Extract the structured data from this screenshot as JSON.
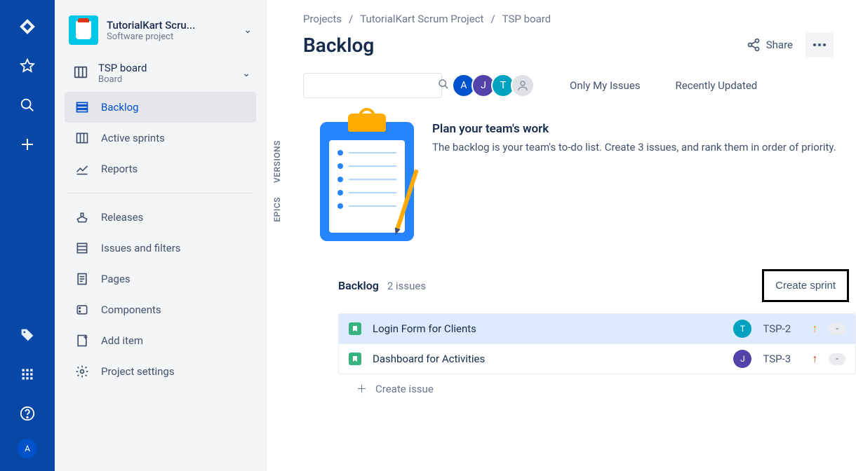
{
  "rail": {
    "user_initial": "A"
  },
  "sidebar": {
    "project": {
      "name": "TutorialKart Scru...",
      "subtitle": "Software project"
    },
    "board": {
      "name": "TSP board",
      "subtitle": "Board"
    },
    "nav": {
      "backlog": "Backlog",
      "active_sprints": "Active sprints",
      "reports": "Reports",
      "releases": "Releases",
      "issues_filters": "Issues and filters",
      "pages": "Pages",
      "components": "Components",
      "add_item": "Add item",
      "project_settings": "Project settings"
    }
  },
  "breadcrumb": {
    "projects": "Projects",
    "project": "TutorialKart Scrum Project",
    "board": "TSP board",
    "sep": "/"
  },
  "header": {
    "title": "Backlog",
    "share": "Share"
  },
  "toolbar": {
    "avatars": {
      "a": "A",
      "j": "J",
      "t": "T"
    },
    "only_my_issues": "Only My Issues",
    "recently_updated": "Recently Updated"
  },
  "vertical_tabs": {
    "versions": "VERSIONS",
    "epics": "EPICS"
  },
  "plan": {
    "heading": "Plan your team's work",
    "body": "The backlog is your team's to-do list. Create 3 issues, and rank them in order of priority."
  },
  "backlog": {
    "title": "Backlog",
    "count_label": "2 issues",
    "create_sprint": "Create sprint",
    "create_issue_label": "Create issue",
    "icon_glyph": "◻",
    "issues": [
      {
        "summary": "Login Form for Clients",
        "assignee_initial": "T",
        "assignee_color": "#00A3BF",
        "key": "TSP-2",
        "priority": "medium",
        "estimate": "-"
      },
      {
        "summary": "Dashboard for Activities",
        "assignee_initial": "J",
        "assignee_color": "#5243AA",
        "key": "TSP-3",
        "priority": "high",
        "estimate": "-"
      }
    ]
  }
}
